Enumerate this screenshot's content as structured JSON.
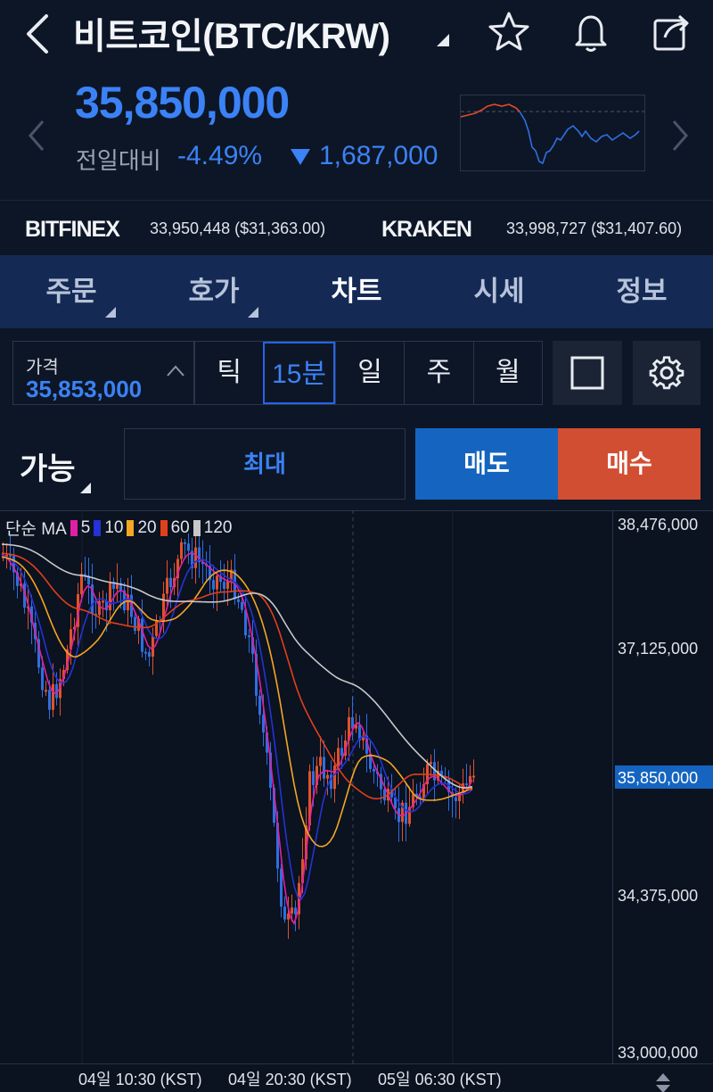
{
  "header": {
    "title": "비트코인(BTC/KRW)"
  },
  "ticker": {
    "price": "35,850,000",
    "change_label": "전일대비",
    "change_pct": "-4.49%",
    "change_amount": "1,687,000",
    "direction": "down"
  },
  "exchanges": [
    {
      "name": "BITFINEX",
      "value": "33,950,448 ($31,363.00)"
    },
    {
      "name": "KRAKEN",
      "value": "33,998,727 ($31,407.60)"
    }
  ],
  "tabs": [
    {
      "label": "주문",
      "has_menu": true,
      "active": false
    },
    {
      "label": "호가",
      "has_menu": true,
      "active": false
    },
    {
      "label": "차트",
      "has_menu": false,
      "active": true
    },
    {
      "label": "시세",
      "has_menu": false,
      "active": false
    },
    {
      "label": "정보",
      "has_menu": false,
      "active": false
    }
  ],
  "price_input": {
    "label": "가격",
    "value": "35,853,000"
  },
  "intervals": [
    {
      "label": "틱",
      "active": false
    },
    {
      "label": "15분",
      "active": true
    },
    {
      "label": "일",
      "active": false
    },
    {
      "label": "주",
      "active": false
    },
    {
      "label": "월",
      "active": false
    }
  ],
  "trade": {
    "available_label": "가능",
    "max_label": "최대",
    "sell_label": "매도",
    "buy_label": "매수"
  },
  "colors": {
    "accent_blue": "#3b82f6",
    "sell_blue": "#1565c0",
    "buy_red": "#d24e33",
    "tab_bg": "#142a55",
    "background": "#0d1626"
  },
  "icons": [
    "back-icon",
    "caret-icon",
    "star-icon",
    "bell-icon",
    "share-icon",
    "chevron-left-icon",
    "chevron-right-icon",
    "chevron-up-icon",
    "square-icon",
    "gear-icon",
    "scroll-handle-icon"
  ],
  "chart_data": {
    "type": "candlestick",
    "indicator_label": "단순 MA",
    "ma": [
      {
        "period": "5",
        "color": "#e11fa5"
      },
      {
        "period": "10",
        "color": "#2433d6"
      },
      {
        "period": "20",
        "color": "#f5a623"
      },
      {
        "period": "60",
        "color": "#e0401a"
      },
      {
        "period": "120",
        "color": "#c8c8c8"
      }
    ],
    "y_ticks": [
      "38,476,000",
      "37,125,000",
      "34,375,000",
      "33,000,000"
    ],
    "current_price_label": "35,850,000",
    "ylim": [
      33000000,
      38476000
    ],
    "x_ticks": [
      "04일 10:30 (KST)",
      "04일 20:30 (KST)",
      "05일 06:30 (KST)"
    ]
  }
}
